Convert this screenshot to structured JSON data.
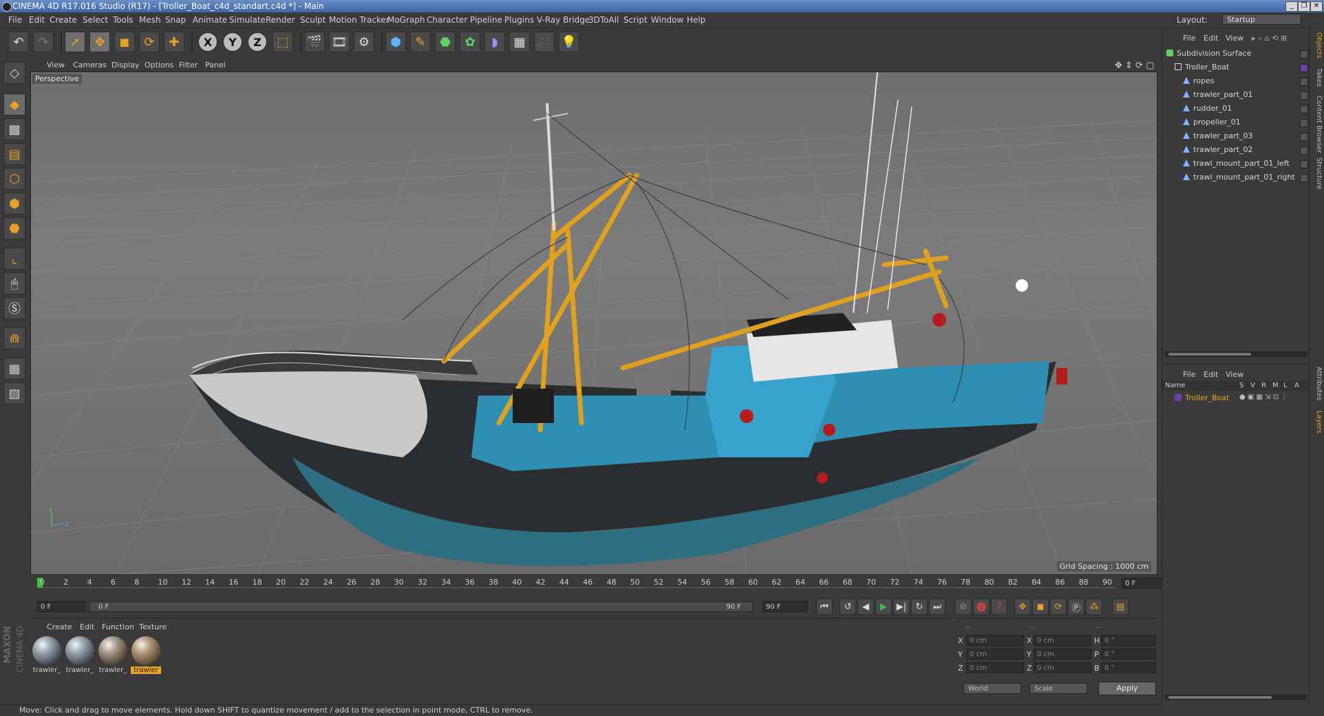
{
  "window": {
    "title": "CINEMA 4D R17.016 Studio (R17) - [Troller_Boat_c4d_standart.c4d *] - Main",
    "buttons": [
      "_",
      "❐",
      "✕"
    ]
  },
  "menubar": {
    "items": [
      "File",
      "Edit",
      "Create",
      "Select",
      "Tools",
      "Mesh",
      "Snap",
      "Animate",
      "Simulate",
      "Render",
      "Sculpt",
      "Motion Tracker",
      "MoGraph",
      "Character",
      "Pipeline",
      "Plugins",
      "V-Ray Bridge",
      "3DToAll",
      "Script",
      "Window",
      "Help"
    ],
    "layout_label": "Layout:",
    "layout_value": "Startup"
  },
  "toolbar": {
    "x_label": "X",
    "y_label": "Y",
    "z_label": "Z"
  },
  "viewport": {
    "menu": [
      "View",
      "Cameras",
      "Display",
      "Options",
      "Filter",
      "Panel"
    ],
    "label": "Perspective",
    "grid_spacing": "Grid Spacing : 1000 cm",
    "axis_y": "y",
    "axis_z": "z"
  },
  "timeline": {
    "ticks": [
      "0",
      "2",
      "4",
      "6",
      "8",
      "10",
      "12",
      "14",
      "16",
      "18",
      "20",
      "22",
      "24",
      "26",
      "28",
      "30",
      "32",
      "34",
      "36",
      "38",
      "40",
      "42",
      "44",
      "46",
      "48",
      "50",
      "52",
      "54",
      "56",
      "58",
      "60",
      "62",
      "64",
      "66",
      "68",
      "70",
      "72",
      "74",
      "76",
      "78",
      "80",
      "82",
      "84",
      "86",
      "88",
      "90"
    ],
    "current_frame": "0 F",
    "start_field": "0 F",
    "range_start": "0 F",
    "range_end": "90 F",
    "end_field": "90 F"
  },
  "materials": {
    "menu": [
      "Create",
      "Edit",
      "Function",
      "Texture"
    ],
    "items": [
      {
        "label": "trawler_",
        "selected": false
      },
      {
        "label": "trawler_",
        "selected": false
      },
      {
        "label": "trawler_",
        "selected": false
      },
      {
        "label": "trawler",
        "selected": true
      }
    ]
  },
  "coordinates": {
    "headers": [
      "--",
      "--",
      "--"
    ],
    "rows": [
      {
        "a": "X",
        "av": "0 cm",
        "b": "X",
        "bv": "0 cm",
        "c": "H",
        "cv": "0 °"
      },
      {
        "a": "Y",
        "av": "0 cm",
        "b": "Y",
        "bv": "0 cm",
        "c": "P",
        "cv": "0 °"
      },
      {
        "a": "Z",
        "av": "0 cm",
        "b": "Z",
        "bv": "0 cm",
        "c": "B",
        "cv": "0 °"
      }
    ],
    "world": "World",
    "scale": "Scale",
    "apply": "Apply"
  },
  "status": {
    "text": "Move: Click and drag to move elements. Hold down SHIFT to quantize movement / add to the selection in point mode, CTRL to remove."
  },
  "objects": {
    "menu": [
      "File",
      "Edit",
      "View"
    ],
    "items": [
      {
        "name": "Subdivision Surface",
        "indent": 0,
        "color": "#5fd35f"
      },
      {
        "name": "Troller_Boat",
        "indent": 1,
        "color": "#d8d8d8"
      },
      {
        "name": "ropes",
        "indent": 2,
        "color": "#7fb2ff"
      },
      {
        "name": "trawler_part_01",
        "indent": 2,
        "color": "#7fb2ff"
      },
      {
        "name": "rudder_01",
        "indent": 2,
        "color": "#7fb2ff"
      },
      {
        "name": "propeller_01",
        "indent": 2,
        "color": "#7fb2ff"
      },
      {
        "name": "trawler_part_03",
        "indent": 2,
        "color": "#7fb2ff"
      },
      {
        "name": "trawler_part_02",
        "indent": 2,
        "color": "#7fb2ff"
      },
      {
        "name": "trawl_mount_part_01_left",
        "indent": 2,
        "color": "#7fb2ff"
      },
      {
        "name": "trawl_mount_part_01_right",
        "indent": 2,
        "color": "#7fb2ff"
      }
    ]
  },
  "layers": {
    "menu": [
      "File",
      "Edit",
      "View"
    ],
    "columns": [
      "Name",
      "S",
      "V",
      "R",
      "M",
      "L",
      "A"
    ],
    "items": [
      {
        "name": "Troller_Boat"
      }
    ]
  },
  "sidetabs": [
    "Objects",
    "Takes",
    "Content Browser",
    "Structure",
    "Attributes",
    "Layers"
  ],
  "logo": {
    "line1": "MAXON",
    "line2": "CINEMA 4D"
  },
  "colors": {
    "accent": "#e7a126",
    "viewport_bg": "#737373",
    "hull_blue": "#2f8fb3"
  }
}
